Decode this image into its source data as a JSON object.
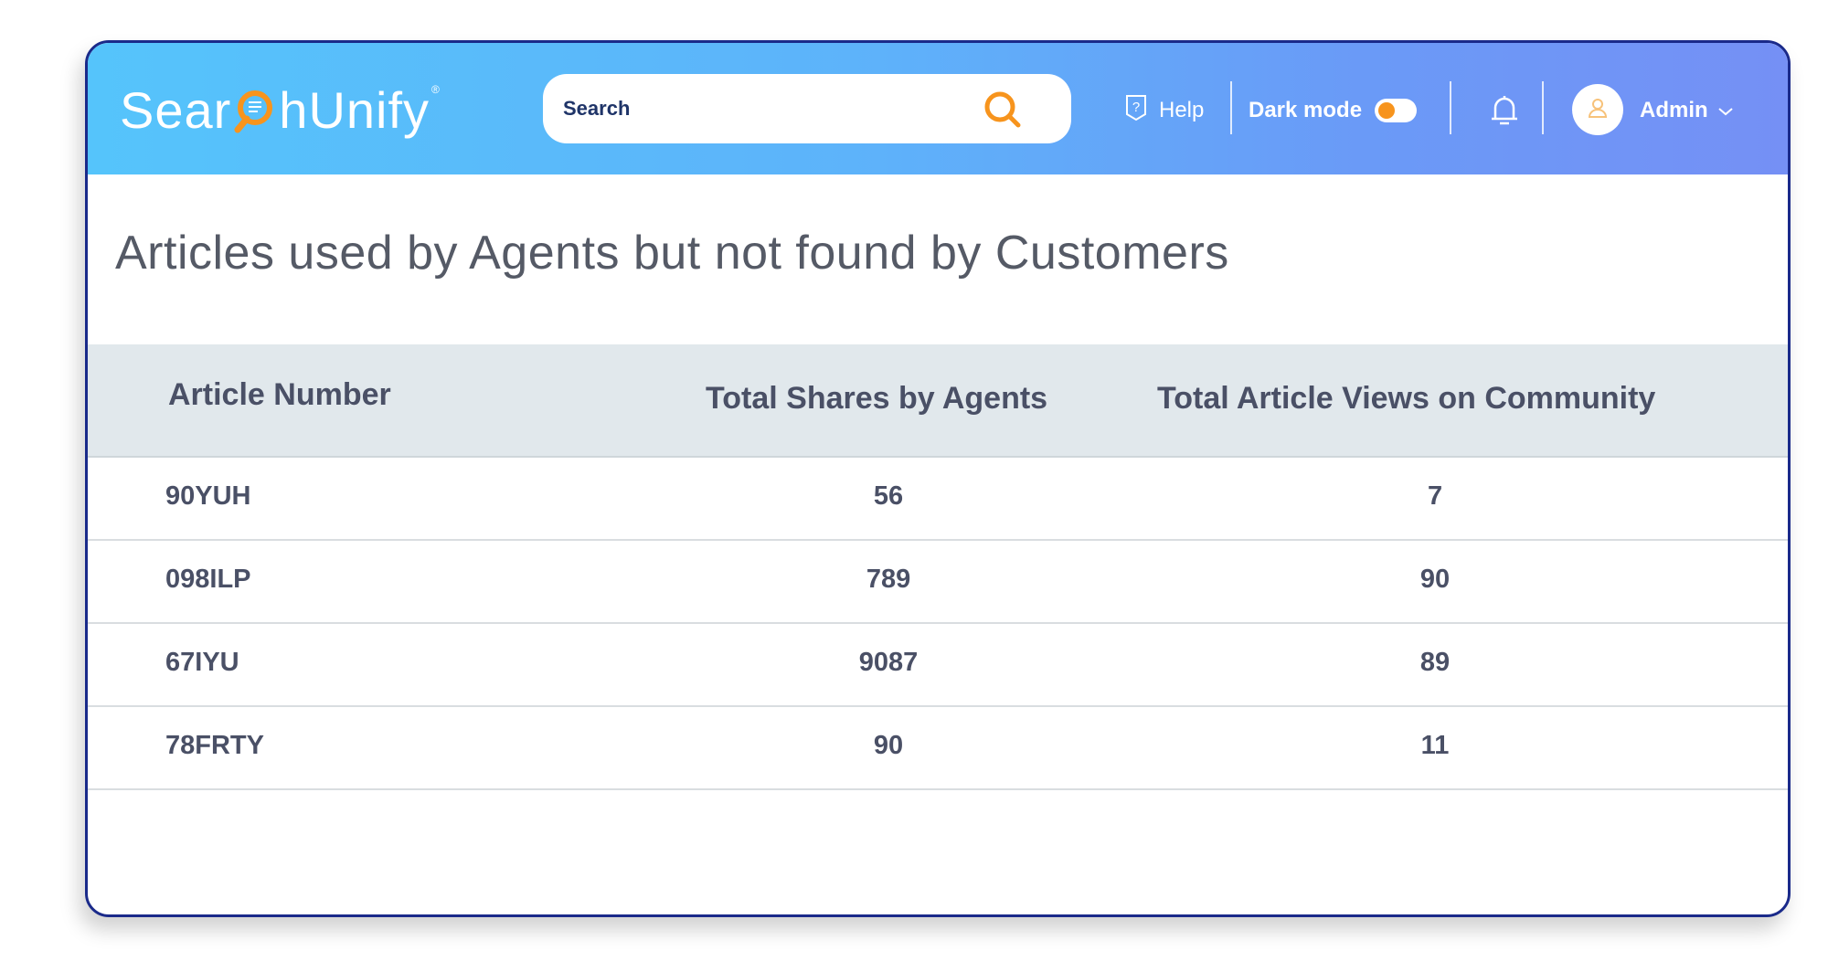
{
  "brand": {
    "logo_text_before": "Sear",
    "logo_text_after": "hUnify",
    "registered_mark": "®"
  },
  "header": {
    "search_placeholder": "Search",
    "help_label": "Help",
    "dark_mode_label": "Dark mode",
    "dark_mode_on": false,
    "user_label": "Admin"
  },
  "colors": {
    "accent_orange": "#f7941d",
    "header_gradient_start": "#55c4fb",
    "header_gradient_end": "#7590f5",
    "text_dark": "#4a5066"
  },
  "report": {
    "title": "Articles used by Agents but not found by Customers",
    "columns": [
      "Article Number",
      "Total Shares by Agents",
      "Total Article Views on Community"
    ],
    "rows": [
      {
        "article": "90YUH",
        "shares": "56",
        "views": "7"
      },
      {
        "article": "098ILP",
        "shares": "789",
        "views": "90"
      },
      {
        "article": "67IYU",
        "shares": "9087",
        "views": "89"
      },
      {
        "article": "78FRTY",
        "shares": "90",
        "views": "11"
      }
    ]
  }
}
